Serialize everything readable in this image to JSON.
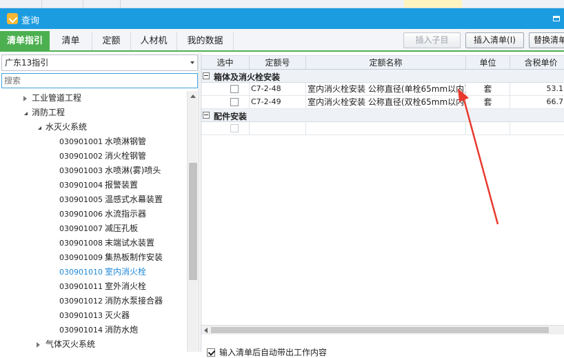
{
  "window": {
    "title": "查询"
  },
  "tabs": [
    {
      "label": "清单指引",
      "active": true
    },
    {
      "label": "清单"
    },
    {
      "label": "定额"
    },
    {
      "label": "人材机"
    },
    {
      "label": "我的数据"
    }
  ],
  "toolbar": {
    "insert_child_label": "插入子目",
    "insert_list_label": "插入清单(I)",
    "replace_list_label": "替换清单"
  },
  "left": {
    "guide_select": "广东13指引",
    "search_placeholder": "搜索",
    "tree": [
      {
        "name": "工业管道工程",
        "level": 1,
        "state": "collapsed"
      },
      {
        "name": "消防工程",
        "level": 1,
        "state": "expanded"
      },
      {
        "name": "水灭火系统",
        "level": 2,
        "state": "expanded"
      },
      {
        "code": "030901001",
        "name": "水喷淋钢管",
        "level": 3
      },
      {
        "code": "030901002",
        "name": "消火栓钢管",
        "level": 3
      },
      {
        "code": "030901003",
        "name": "水喷淋(雾)喷头",
        "level": 3
      },
      {
        "code": "030901004",
        "name": "报警装置",
        "level": 3
      },
      {
        "code": "030901005",
        "name": "温感式水幕装置",
        "level": 3
      },
      {
        "code": "030901006",
        "name": "水流指示器",
        "level": 3
      },
      {
        "code": "030901007",
        "name": "减压孔板",
        "level": 3
      },
      {
        "code": "030901008",
        "name": "末端试水装置",
        "level": 3
      },
      {
        "code": "030901009",
        "name": "集热板制作安装",
        "level": 3
      },
      {
        "code": "030901010",
        "name": "室内消火栓",
        "level": 3,
        "selected": true
      },
      {
        "code": "030901011",
        "name": "室外消火栓",
        "level": 3
      },
      {
        "code": "030901012",
        "name": "消防水泵接合器",
        "level": 3
      },
      {
        "code": "030901013",
        "name": "灭火器",
        "level": 3
      },
      {
        "code": "030901014",
        "name": "消防水炮",
        "level": 3
      },
      {
        "name": "气体灭火系统",
        "level": 2,
        "state": "collapsed"
      }
    ]
  },
  "grid": {
    "columns": [
      "选中",
      "定额号",
      "定额名称",
      "单位",
      "含税单价"
    ],
    "groups": [
      {
        "title": "箱体及消火栓安装",
        "rows": [
          {
            "code": "C7-2-48",
            "name": "室内消火栓安装 公称直径(单栓65mm以内)",
            "unit": "套",
            "price": "53.1"
          },
          {
            "code": "C7-2-49",
            "name": "室内消火栓安装 公称直径(双栓65mm以内)",
            "unit": "套",
            "price": "66.7"
          }
        ]
      },
      {
        "title": "配件安装",
        "rows": [
          {
            "code": "",
            "name": "",
            "unit": "",
            "price": ""
          }
        ]
      }
    ]
  },
  "footer": {
    "auto_work_label": "输入清单后自动带出工作内容"
  },
  "colors": {
    "title_bar": "#1c9ce0",
    "active_tab": "#4cb050",
    "annotation_arrow": "#e8392d",
    "selected_item": "#1f88d8"
  }
}
